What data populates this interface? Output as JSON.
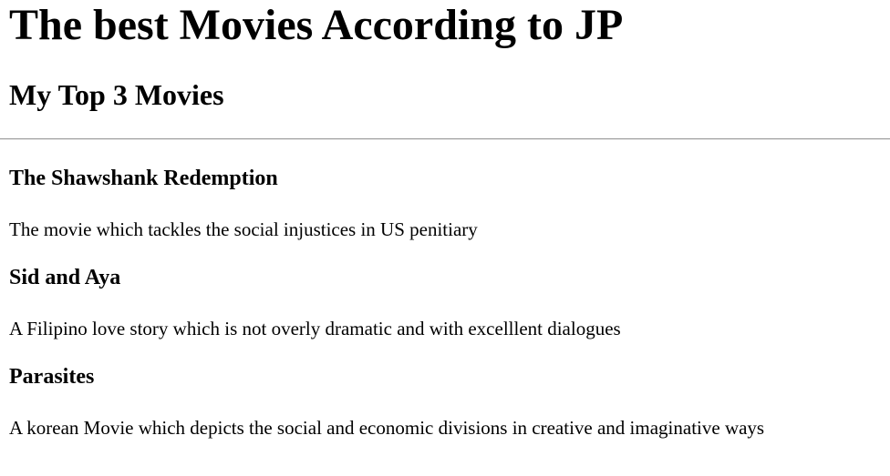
{
  "header": {
    "title": "The best Movies According to JP",
    "subtitle": "My Top 3 Movies"
  },
  "movies": [
    {
      "title": "The Shawshank Redemption",
      "description": "The movie which tackles the social injustices in US penitiary"
    },
    {
      "title": "Sid and Aya",
      "description": "A Filipino love story which is not overly dramatic and with excelllent dialogues"
    },
    {
      "title": "Parasites",
      "description": "A korean Movie which depicts the social and economic divisions in creative and imaginative ways"
    }
  ]
}
